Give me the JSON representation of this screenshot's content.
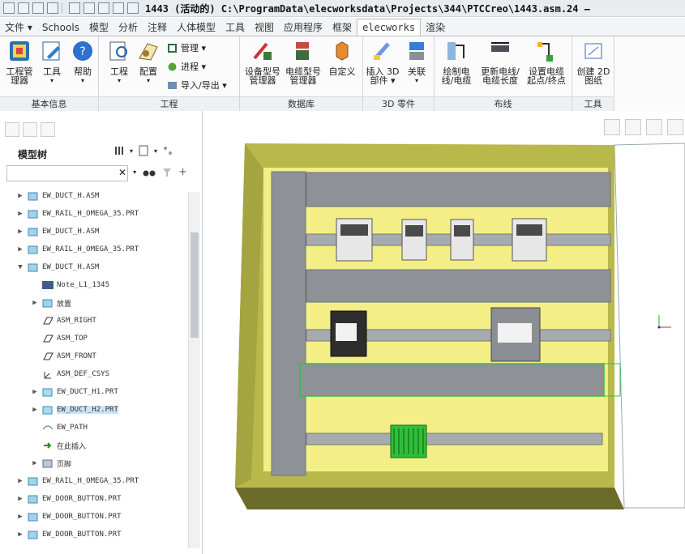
{
  "titlebar": {
    "title": "1443 (活动的) C:\\ProgramData\\elecworksdata\\Projects\\344\\PTCCreo\\1443.asm.24 —"
  },
  "tabs": [
    {
      "label": "文件 ▾"
    },
    {
      "label": "Schools"
    },
    {
      "label": "模型"
    },
    {
      "label": "分析"
    },
    {
      "label": "注释"
    },
    {
      "label": "人体模型"
    },
    {
      "label": "工具"
    },
    {
      "label": "视图"
    },
    {
      "label": "应用程序"
    },
    {
      "label": "框架"
    },
    {
      "label": "elecworks"
    },
    {
      "label": "渲染"
    }
  ],
  "active_tab": "elecworks",
  "ribbon": {
    "groups": [
      {
        "label": "基本信息"
      },
      {
        "label": "工程"
      },
      {
        "label": "数据库"
      },
      {
        "label": "3D 零件"
      },
      {
        "label": "布线"
      },
      {
        "label": "工具"
      }
    ],
    "buttons": {
      "project_manager": "工程管\n理器",
      "tools": "工具",
      "help": "帮助",
      "project": "工程",
      "config": "配置",
      "manage": "管理 ▾",
      "process": "进程 ▾",
      "import_export": "导入/导出 ▾",
      "device_model_manager": "设备型号\n管理器",
      "cable_model_manager": "电缆型号\n管理器",
      "custom": "自定义",
      "insert_part": "插入 3D\n部件 ▾",
      "associate": "关联",
      "draw_wire": "绘制电\n线/电缆",
      "update_wire_length": "更新电线/\n电缆长度",
      "set_cable_endpoints": "设置电缆\n起点/终点",
      "create_2d_drawing": "创建 2D\n图纸"
    }
  },
  "panel": {
    "title": "模型树",
    "search_placeholder": ""
  },
  "tree": [
    {
      "text": "EW_DUCT_H.ASM",
      "exp": "▶",
      "icon": "asm",
      "selected": false
    },
    {
      "text": "EW_RAIL_H_OMEGA_35.PRT",
      "exp": "▶",
      "icon": "asm",
      "selected": false
    },
    {
      "text": "EW_DUCT_H.ASM",
      "exp": "▶",
      "icon": "asm",
      "selected": false
    },
    {
      "text": "EW_RAIL_H_OMEGA_35.PRT",
      "exp": "▶",
      "icon": "asm",
      "selected": false
    },
    {
      "text": "EW_DUCT_H.ASM",
      "exp": "▼",
      "icon": "asm",
      "selected": false
    },
    {
      "text": "Note_L1_1345",
      "exp": "",
      "icon": "note",
      "selected": false,
      "indent": 1
    },
    {
      "text": "放置",
      "exp": "▶",
      "icon": "asm",
      "selected": false,
      "indent": 1
    },
    {
      "text": "ASM_RIGHT",
      "exp": "",
      "icon": "plane",
      "selected": false,
      "indent": 1
    },
    {
      "text": "ASM_TOP",
      "exp": "",
      "icon": "plane",
      "selected": false,
      "indent": 1
    },
    {
      "text": "ASM_FRONT",
      "exp": "",
      "icon": "plane",
      "selected": false,
      "indent": 1
    },
    {
      "text": "ASM_DEF_CSYS",
      "exp": "",
      "icon": "csys",
      "selected": false,
      "indent": 1
    },
    {
      "text": "EW_DUCT_H1.PRT",
      "exp": "▶",
      "icon": "prt",
      "selected": false,
      "indent": 1
    },
    {
      "text": "EW_DUCT_H2.PRT",
      "exp": "▶",
      "icon": "prt",
      "selected": true,
      "indent": 1
    },
    {
      "text": "EW_PATH",
      "exp": "",
      "icon": "path",
      "selected": false,
      "indent": 1
    },
    {
      "text": "在此插入",
      "exp": "",
      "icon": "arrow",
      "selected": false,
      "indent": 1
    },
    {
      "text": "页脚",
      "exp": "▶",
      "icon": "footer",
      "selected": false,
      "indent": 1
    },
    {
      "text": "EW_RAIL_H_OMEGA_35.PRT",
      "exp": "▶",
      "icon": "asm",
      "selected": false
    },
    {
      "text": "EW_DOOR_BUTTON.PRT",
      "exp": "▶",
      "icon": "asm",
      "selected": false
    },
    {
      "text": "EW_DOOR_BUTTON.PRT",
      "exp": "▶",
      "icon": "asm",
      "selected": false
    },
    {
      "text": "EW_DOOR_BUTTON.PRT",
      "exp": "▶",
      "icon": "asm",
      "selected": false
    }
  ],
  "colors": {
    "panel_yellow": "#f3ef86",
    "duct_gray": "#8e9297",
    "frame_olive": "#b9b94b",
    "frame_dark": "#6b6b2a",
    "terminal_green": "#2fbf3a"
  }
}
